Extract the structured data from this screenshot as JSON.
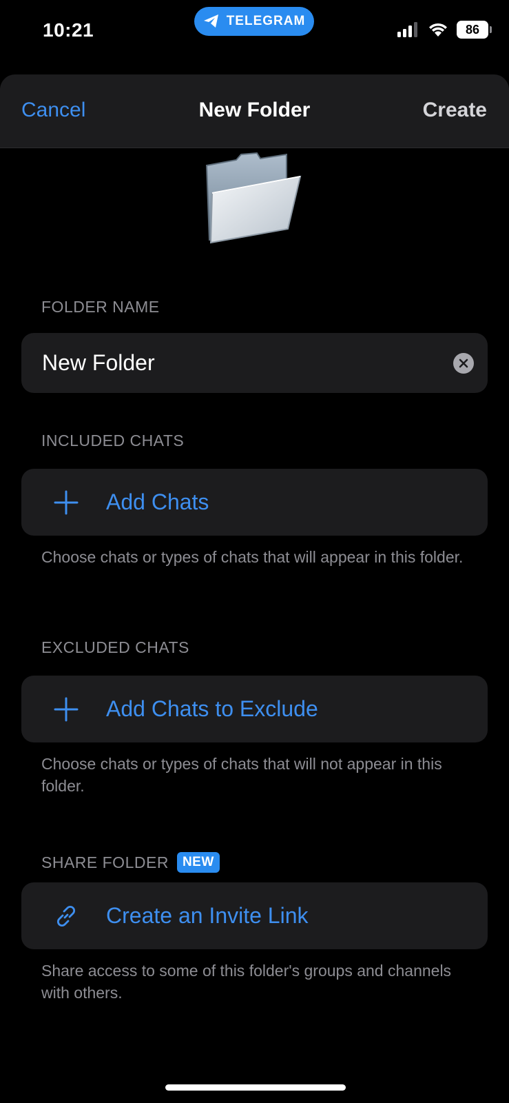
{
  "status_bar": {
    "time": "10:21",
    "app_pill_label": "TELEGRAM",
    "battery_level": "86",
    "accent_color": "#2a8cf0"
  },
  "nav": {
    "cancel_label": "Cancel",
    "title": "New Folder",
    "create_label": "Create"
  },
  "folder_name": {
    "header": "FOLDER NAME",
    "value": "New Folder"
  },
  "included_chats": {
    "header": "INCLUDED CHATS",
    "action_label": "Add Chats",
    "action_icon": "plus-icon",
    "footer": "Choose chats or types of chats that will appear in this folder."
  },
  "excluded_chats": {
    "header": "EXCLUDED CHATS",
    "action_label": "Add Chats to Exclude",
    "action_icon": "plus-icon",
    "footer": "Choose chats or types of chats that will not appear in this folder."
  },
  "share_folder": {
    "header": "SHARE FOLDER",
    "badge": "NEW",
    "action_label": "Create an Invite Link",
    "action_icon": "link-icon",
    "footer": "Share access to some of this folder's groups and channels with others."
  },
  "colors": {
    "link_blue": "#3e8ff0",
    "card_bg": "#1c1c1e",
    "secondary_text": "#8d8d93"
  }
}
